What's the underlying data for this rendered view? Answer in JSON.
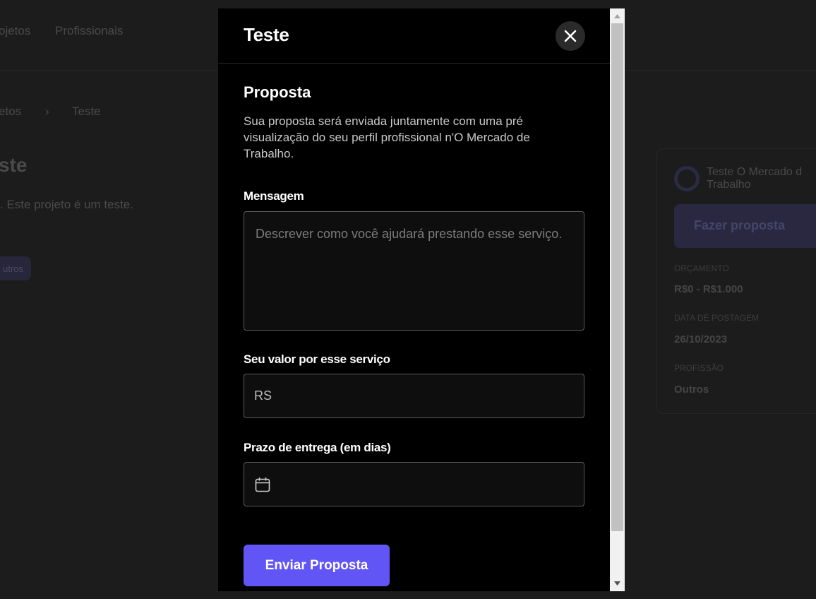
{
  "background": {
    "nav": {
      "item1": "ojetos",
      "item2": "Profissionais"
    },
    "breadcrumb": {
      "parent": "etos",
      "separator": "›",
      "current": "Teste"
    },
    "title": "ste",
    "description": ". Este projeto é um teste.",
    "tag": "utros",
    "card": {
      "company": "Teste O Mercado d Trabalho",
      "button": "Fazer proposta",
      "budget_label": "ORÇAMENTO",
      "budget_value": "R$0 - R$1.000",
      "date_label": "DATA DE POSTAGEM",
      "date_value": "26/10/2023",
      "profession_label": "PROFISSÃO",
      "profession_value": "Outros"
    }
  },
  "modal": {
    "title": "Teste",
    "section_title": "Proposta",
    "section_desc": "Sua proposta será enviada juntamente com uma pré visualização do seu perfil profissional n'O Mercado de Trabalho.",
    "message": {
      "label": "Mensagem",
      "placeholder": "Descrever como você ajudará prestando esse serviço.",
      "value": ""
    },
    "price": {
      "label": "Seu valor por esse serviço",
      "placeholder": "RS",
      "value": ""
    },
    "deadline": {
      "label": "Prazo de entrega (em dias)",
      "value": ""
    },
    "submit": "Enviar Proposta"
  },
  "colors": {
    "accent": "#6255f5",
    "modal_bg": "#000000",
    "overlay_bg": "#1c1c1c"
  }
}
